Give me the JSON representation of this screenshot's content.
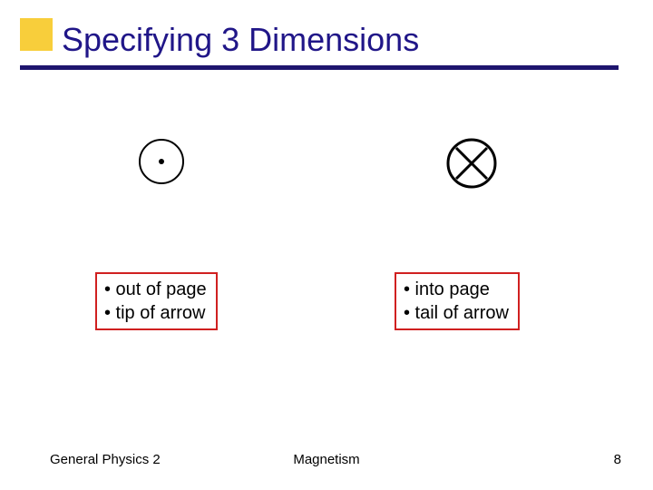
{
  "title": "Specifying 3 Dimensions",
  "left": {
    "legend_line1": "• out of page",
    "legend_line2": "• tip of arrow",
    "symbol_name": "out-of-page-symbol"
  },
  "right": {
    "legend_line1": "• into page",
    "legend_line2": "• tail of arrow",
    "symbol_name": "into-page-symbol"
  },
  "footer": {
    "left": "General Physics 2",
    "center": "Magnetism",
    "right": "8"
  },
  "colors": {
    "title": "#201688",
    "divider": "#1e156e",
    "accent_square": "#f8ce3b",
    "legend_border": "#d02020"
  }
}
